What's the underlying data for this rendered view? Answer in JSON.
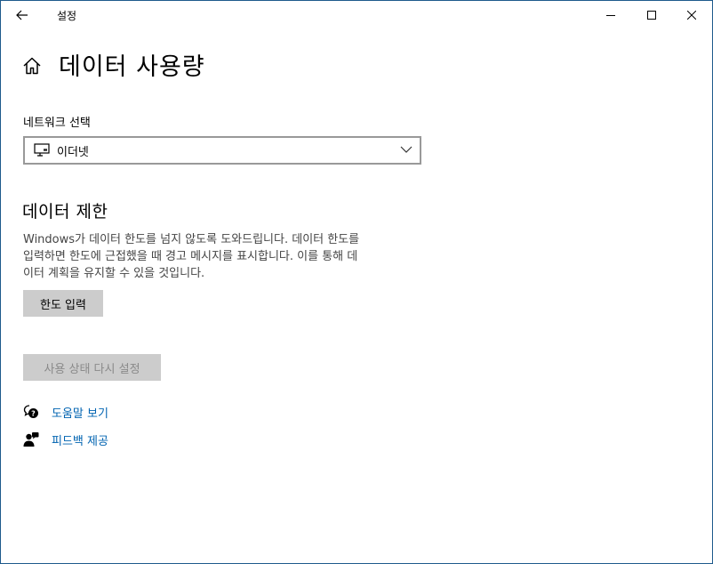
{
  "window": {
    "title": "설정"
  },
  "page": {
    "title": "데이터 사용량"
  },
  "network": {
    "label": "네트워크 선택",
    "selected": "이더넷",
    "icon": "ethernet-icon"
  },
  "data_limit": {
    "title": "데이터 제한",
    "description_lines": [
      "Windows가 데이터 한도를 넘지 않도록 도와드립니다. 데이터 한도를",
      "입력하면 한도에 근접했을 때 경고 메시지를 표시합니다. 이를 통해 데",
      "이터 계획을 유지할 수 있을 것입니다."
    ],
    "enter_limit_label": "한도 입력",
    "reset_usage_label": "사용 상태 다시 설정"
  },
  "links": {
    "help_label": "도움말 보기",
    "feedback_label": "피드백 제공"
  },
  "colors": {
    "link": "#0063b1",
    "button_bg": "#cccccc",
    "disabled_text": "#8a8a8a"
  }
}
